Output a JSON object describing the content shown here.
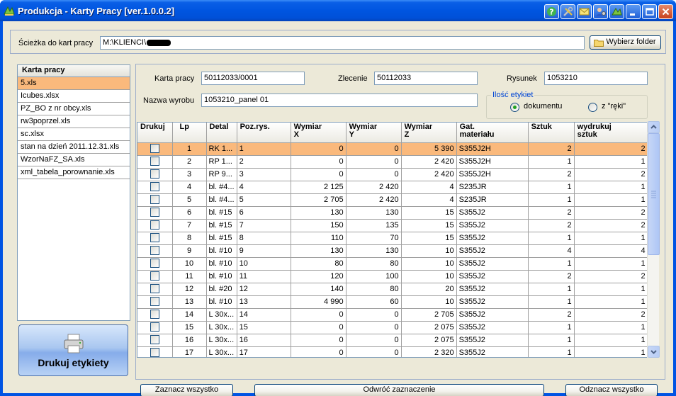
{
  "window": {
    "title": "Produkcja - Karty Pracy [ver.1.0.0.2]"
  },
  "path": {
    "label": "Ścieżka do kart pracy",
    "value": "M:\\KLIENCI\\",
    "button": "Wybierz folder"
  },
  "files": {
    "header": "Karta pracy",
    "items": [
      "5.xls",
      "Icubes.xlsx",
      "PZ_BO z nr obcy.xls",
      "rw3poprzel.xls",
      "sc.xlsx",
      "stan na dzień 2011.12.31.xls",
      "WzorNaFZ_SA.xls",
      "xml_tabela_porownanie.xls"
    ]
  },
  "print_button": {
    "label": "Drukuj etykiety"
  },
  "form": {
    "karta_label": "Karta pracy",
    "karta_value": "50112033/0001",
    "zlecenie_label": "Zlecenie",
    "zlecenie_value": "50112033",
    "rysunek_label": "Rysunek",
    "rysunek_value": "1053210",
    "nazwa_label": "Nazwa wyrobu",
    "nazwa_value": "1053210_panel 01",
    "ilosc_title": "Ilość etykiet",
    "radio_doc": "dokumentu",
    "radio_hand": "z \"ręki\"",
    "radio_selected": "dokumentu"
  },
  "table": {
    "headers": {
      "drukuj": "Drukuj",
      "lp": "Lp",
      "detal": "Detal",
      "poz": "Poz.rys.",
      "wx1": "Wymiar",
      "wx2": "X",
      "wy1": "Wymiar",
      "wy2": "Y",
      "wz1": "Wymiar",
      "wz2": "Z",
      "gat1": "Gat.",
      "gat2": "materiału",
      "sztuk": "Sztuk",
      "wyd1": "wydrukuj",
      "wyd2": "sztuk"
    },
    "rows": [
      {
        "lp": "1",
        "detal": "RK 1...",
        "poz": "1",
        "x": "0",
        "y": "0",
        "z": "5 390",
        "gat": "S355J2H",
        "sztuk": "2",
        "wyd": "2"
      },
      {
        "lp": "2",
        "detal": "RP 1...",
        "poz": "2",
        "x": "0",
        "y": "0",
        "z": "2 420",
        "gat": "S355J2H",
        "sztuk": "1",
        "wyd": "1"
      },
      {
        "lp": "3",
        "detal": "RP 9...",
        "poz": "3",
        "x": "0",
        "y": "0",
        "z": "2 420",
        "gat": "S355J2H",
        "sztuk": "2",
        "wyd": "2"
      },
      {
        "lp": "4",
        "detal": "bl. #4...",
        "poz": "4",
        "x": "2 125",
        "y": "2 420",
        "z": "4",
        "gat": "S235JR",
        "sztuk": "1",
        "wyd": "1"
      },
      {
        "lp": "5",
        "detal": "bl. #4...",
        "poz": "5",
        "x": "2 705",
        "y": "2 420",
        "z": "4",
        "gat": "S235JR",
        "sztuk": "1",
        "wyd": "1"
      },
      {
        "lp": "6",
        "detal": "bl. #15",
        "poz": "6",
        "x": "130",
        "y": "130",
        "z": "15",
        "gat": "S355J2",
        "sztuk": "2",
        "wyd": "2"
      },
      {
        "lp": "7",
        "detal": "bl. #15",
        "poz": "7",
        "x": "150",
        "y": "135",
        "z": "15",
        "gat": "S355J2",
        "sztuk": "2",
        "wyd": "2"
      },
      {
        "lp": "8",
        "detal": "bl. #15",
        "poz": "8",
        "x": "110",
        "y": "70",
        "z": "15",
        "gat": "S355J2",
        "sztuk": "1",
        "wyd": "1"
      },
      {
        "lp": "9",
        "detal": "bl. #10",
        "poz": "9",
        "x": "130",
        "y": "130",
        "z": "10",
        "gat": "S355J2",
        "sztuk": "4",
        "wyd": "4"
      },
      {
        "lp": "10",
        "detal": "bl. #10",
        "poz": "10",
        "x": "80",
        "y": "80",
        "z": "10",
        "gat": "S355J2",
        "sztuk": "1",
        "wyd": "1"
      },
      {
        "lp": "11",
        "detal": "bl. #10",
        "poz": "11",
        "x": "120",
        "y": "100",
        "z": "10",
        "gat": "S355J2",
        "sztuk": "2",
        "wyd": "2"
      },
      {
        "lp": "12",
        "detal": "bl. #20",
        "poz": "12",
        "x": "140",
        "y": "80",
        "z": "20",
        "gat": "S355J2",
        "sztuk": "1",
        "wyd": "1"
      },
      {
        "lp": "13",
        "detal": "bl. #10",
        "poz": "13",
        "x": "4 990",
        "y": "60",
        "z": "10",
        "gat": "S355J2",
        "sztuk": "1",
        "wyd": "1"
      },
      {
        "lp": "14",
        "detal": "L 30x...",
        "poz": "14",
        "x": "0",
        "y": "0",
        "z": "2 705",
        "gat": "S355J2",
        "sztuk": "2",
        "wyd": "2"
      },
      {
        "lp": "15",
        "detal": "L 30x...",
        "poz": "15",
        "x": "0",
        "y": "0",
        "z": "2 075",
        "gat": "S355J2",
        "sztuk": "1",
        "wyd": "1"
      },
      {
        "lp": "16",
        "detal": "L 30x...",
        "poz": "16",
        "x": "0",
        "y": "0",
        "z": "2 075",
        "gat": "S355J2",
        "sztuk": "1",
        "wyd": "1"
      },
      {
        "lp": "17",
        "detal": "L 30x...",
        "poz": "17",
        "x": "0",
        "y": "0",
        "z": "2 320",
        "gat": "S355J2",
        "sztuk": "1",
        "wyd": "1"
      }
    ]
  },
  "buttons": {
    "select_all": "Zaznacz wszystko",
    "invert": "Odwróć zaznaczenie",
    "deselect_all": "Odznacz wszystko"
  },
  "colors": {
    "selection": "#fab97c",
    "titlebar": "#0055e0",
    "face": "#ece9d8"
  }
}
